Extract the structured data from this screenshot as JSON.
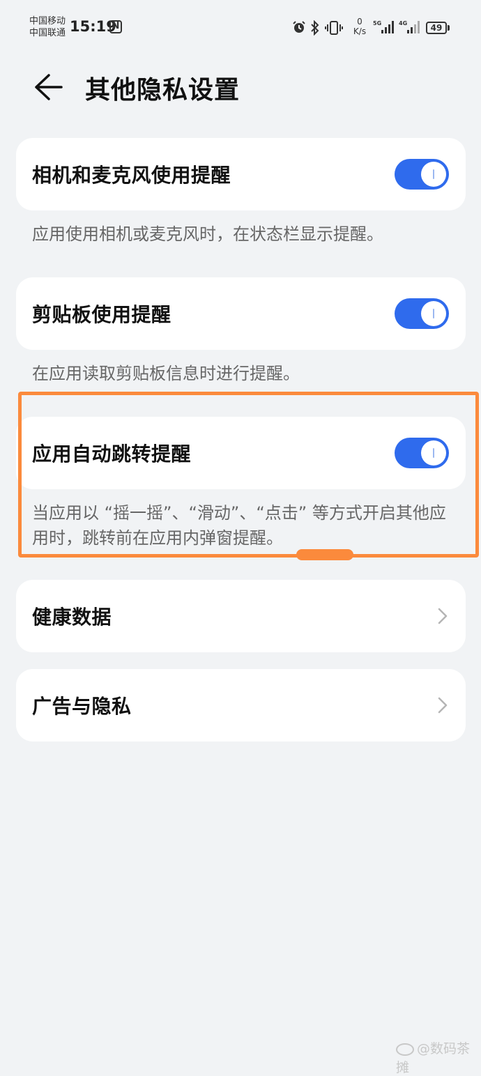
{
  "status_bar": {
    "carrier1": "中国移动",
    "carrier2": "中国联通",
    "time": "15:19",
    "nfc": "N",
    "speed_value": "0",
    "speed_unit": "K/s",
    "net1": "5G",
    "net2": "4G",
    "battery": "49"
  },
  "header": {
    "title": "其他隐私设置",
    "back_icon": "arrow-left-icon"
  },
  "settings": {
    "camera_mic": {
      "label": "相机和麦克风使用提醒",
      "enabled": true,
      "description": "应用使用相机或麦克风时，在状态栏显示提醒。"
    },
    "clipboard": {
      "label": "剪贴板使用提醒",
      "enabled": true,
      "description": "在应用读取剪贴板信息时进行提醒。"
    },
    "auto_jump": {
      "label": "应用自动跳转提醒",
      "enabled": true,
      "description": "当应用以 “摇一摇”、“滑动”、“点击” 等方式开启其他应用时，跳转前在应用内弹窗提醒。"
    },
    "health_data": {
      "label": "健康数据"
    },
    "ads_privacy": {
      "label": "广告与隐私"
    }
  },
  "watermark": "@数码茶摊",
  "colors": {
    "toggle_on": "#2f6bed",
    "highlight": "#fb8a3c",
    "background": "#f1f3f5"
  }
}
